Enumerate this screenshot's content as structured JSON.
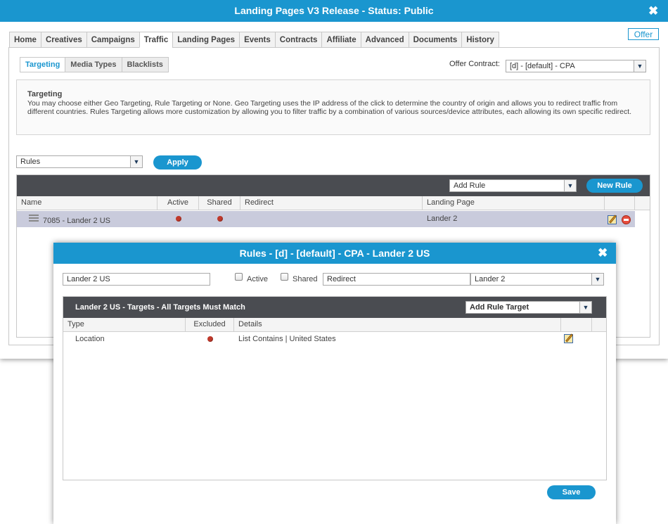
{
  "window": {
    "title": "Landing Pages V3 Release - Status: Public",
    "close_glyph": "✖",
    "offer_button": "Offer"
  },
  "tabs": [
    "Home",
    "Creatives",
    "Campaigns",
    "Traffic",
    "Landing Pages",
    "Events",
    "Contracts",
    "Affiliate",
    "Advanced",
    "Documents",
    "History"
  ],
  "active_tab": "Traffic",
  "subtabs": [
    "Targeting",
    "Media Types",
    "Blacklists"
  ],
  "active_subtab": "Targeting",
  "offer_contract": {
    "label": "Offer Contract:",
    "value": "[d] - [default] - CPA"
  },
  "info": {
    "title": "Targeting",
    "text": "You may choose either Geo Targeting, Rule Targeting or None. Geo Targeting uses the IP address of the click to determine the country of origin and allows you to redirect traffic from different countries. Rules Targeting allows more customization by allowing you to filter traffic by a combination of various sources/device attributes, each allowing its own specific redirect."
  },
  "targeting_mode": {
    "value": "Rules",
    "apply_label": "Apply"
  },
  "rules_panel": {
    "add_rule_select": "Add Rule",
    "new_rule_label": "New Rule",
    "columns": [
      "Name",
      "Active",
      "Shared",
      "Redirect",
      "Landing Page"
    ],
    "rows": [
      {
        "name": "7085 - Lander 2 US",
        "active": true,
        "shared": true,
        "redirect": "",
        "landing_page": "Lander 2"
      }
    ]
  },
  "modal": {
    "title": "Rules - [d] - [default] - CPA - Lander 2 US",
    "close_glyph": "✖",
    "name_value": "Lander 2 US",
    "active_label": "Active",
    "shared_label": "Shared",
    "redirect_placeholder": "Redirect",
    "landing_page_value": "Lander 2",
    "targets_title": "Lander 2 US - Targets - All Targets Must Match",
    "add_target_select": "Add Rule Target",
    "columns": [
      "Type",
      "Excluded",
      "Details"
    ],
    "rows": [
      {
        "type": "Location",
        "excluded": true,
        "details": "List Contains | United States"
      }
    ],
    "save_label": "Save"
  },
  "colors": {
    "accent": "#1a96cf",
    "dark_bar": "#4a4c51",
    "selected_row": "#c9cbdc",
    "status_dot": "#c0392b"
  },
  "icons": {
    "close": "close-icon",
    "dropdown": "chevron-down-icon",
    "drag": "drag-handle-icon",
    "edit": "edit-icon",
    "delete": "delete-icon",
    "status": "status-dot-icon"
  }
}
